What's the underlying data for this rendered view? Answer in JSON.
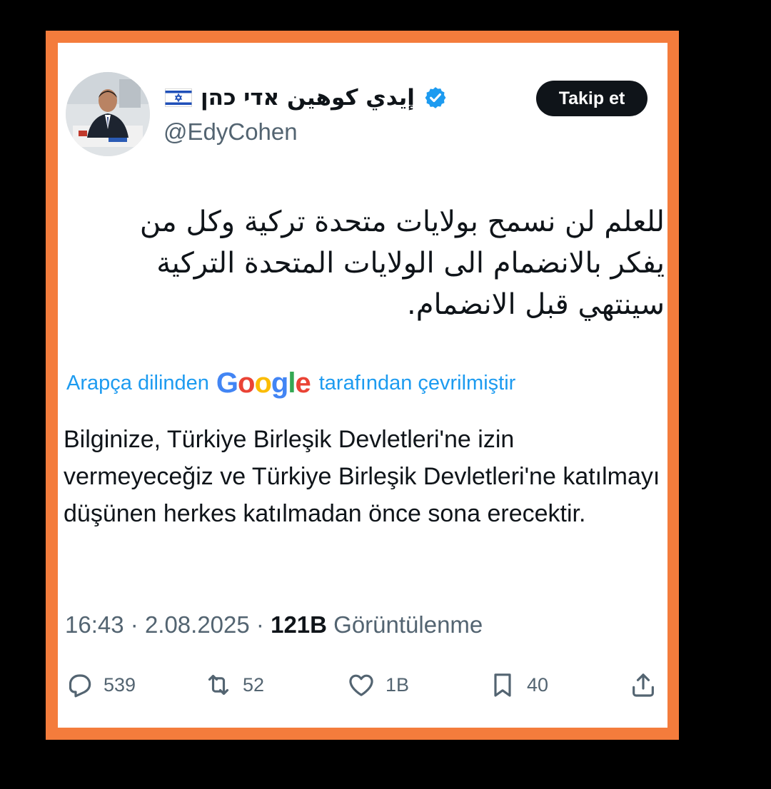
{
  "tweet": {
    "author": {
      "display_name": "إيدي كوهين אדי כהן",
      "handle": "@EdyCohen",
      "avatar_icon": "profile-photo",
      "flag_icon": "israel-flag",
      "verified_icon": "verified-badge"
    },
    "follow_label": "Takip et",
    "original_lines": "للعلم لن نسمح بولايات متحدة تركية   وكل من\nيفكر بالانضمام الى الولايات المتحدة التركية\nسينتهي قبل الانضمام.",
    "translation": {
      "prefix": "Arapça dilinden",
      "logo_letters": [
        "G",
        "o",
        "o",
        "g",
        "l",
        "e"
      ],
      "suffix": "tarafından çevrilmiştir",
      "text": "Bilginize, Türkiye Birleşik Devletleri'ne izin vermeyeceğiz ve Türkiye Birleşik Devletleri'ne katılmayı düşünen herkes katılmadan önce sona erecektir."
    },
    "meta": {
      "time": "16:43",
      "date": "2.08.2025",
      "views_count": "121B",
      "views_label": "Görüntülenme"
    },
    "actions": {
      "replies": "539",
      "reposts": "52",
      "likes": "1B",
      "bookmarks": "40"
    }
  },
  "colors": {
    "frame": "#f47c3c",
    "link_blue": "#1d9bf0",
    "text_primary": "#0f1419",
    "text_secondary": "#536471",
    "google_blue": "#4285F4",
    "google_red": "#EA4335",
    "google_yellow": "#FBBC05",
    "google_green": "#34A853"
  }
}
